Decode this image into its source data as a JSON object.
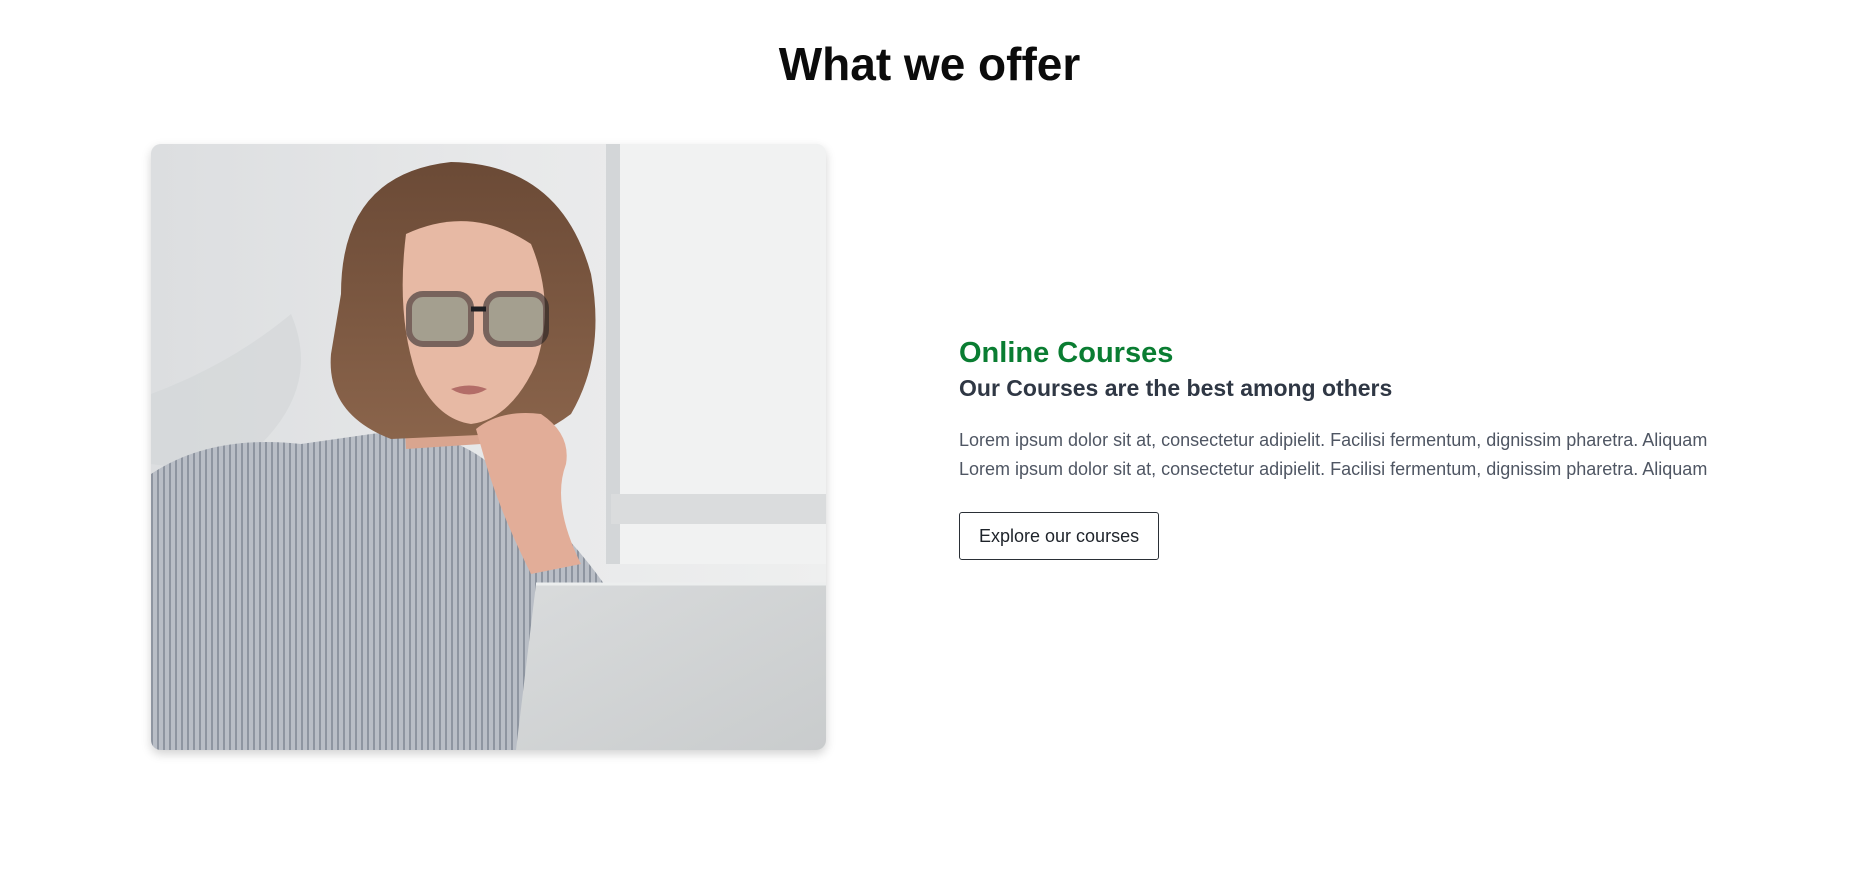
{
  "section": {
    "title": "What we offer"
  },
  "feature": {
    "image_alt": "Woman with glasses working on a laptop",
    "title": "Online Courses",
    "subtitle": "Our Courses are the best among others",
    "description_lines": [
      "Lorem ipsum dolor sit at, consectetur adipielit. Facilisi fermentum, dignissim pharetra. Aliquam",
      "Lorem ipsum dolor sit at, consectetur adipielit. Facilisi fermentum, dignissim pharetra. Aliquam"
    ],
    "button_label": "Explore our courses"
  },
  "colors": {
    "accent_green": "#0a7d32",
    "subtitle": "#2f3744",
    "body_text": "#4f5663"
  }
}
